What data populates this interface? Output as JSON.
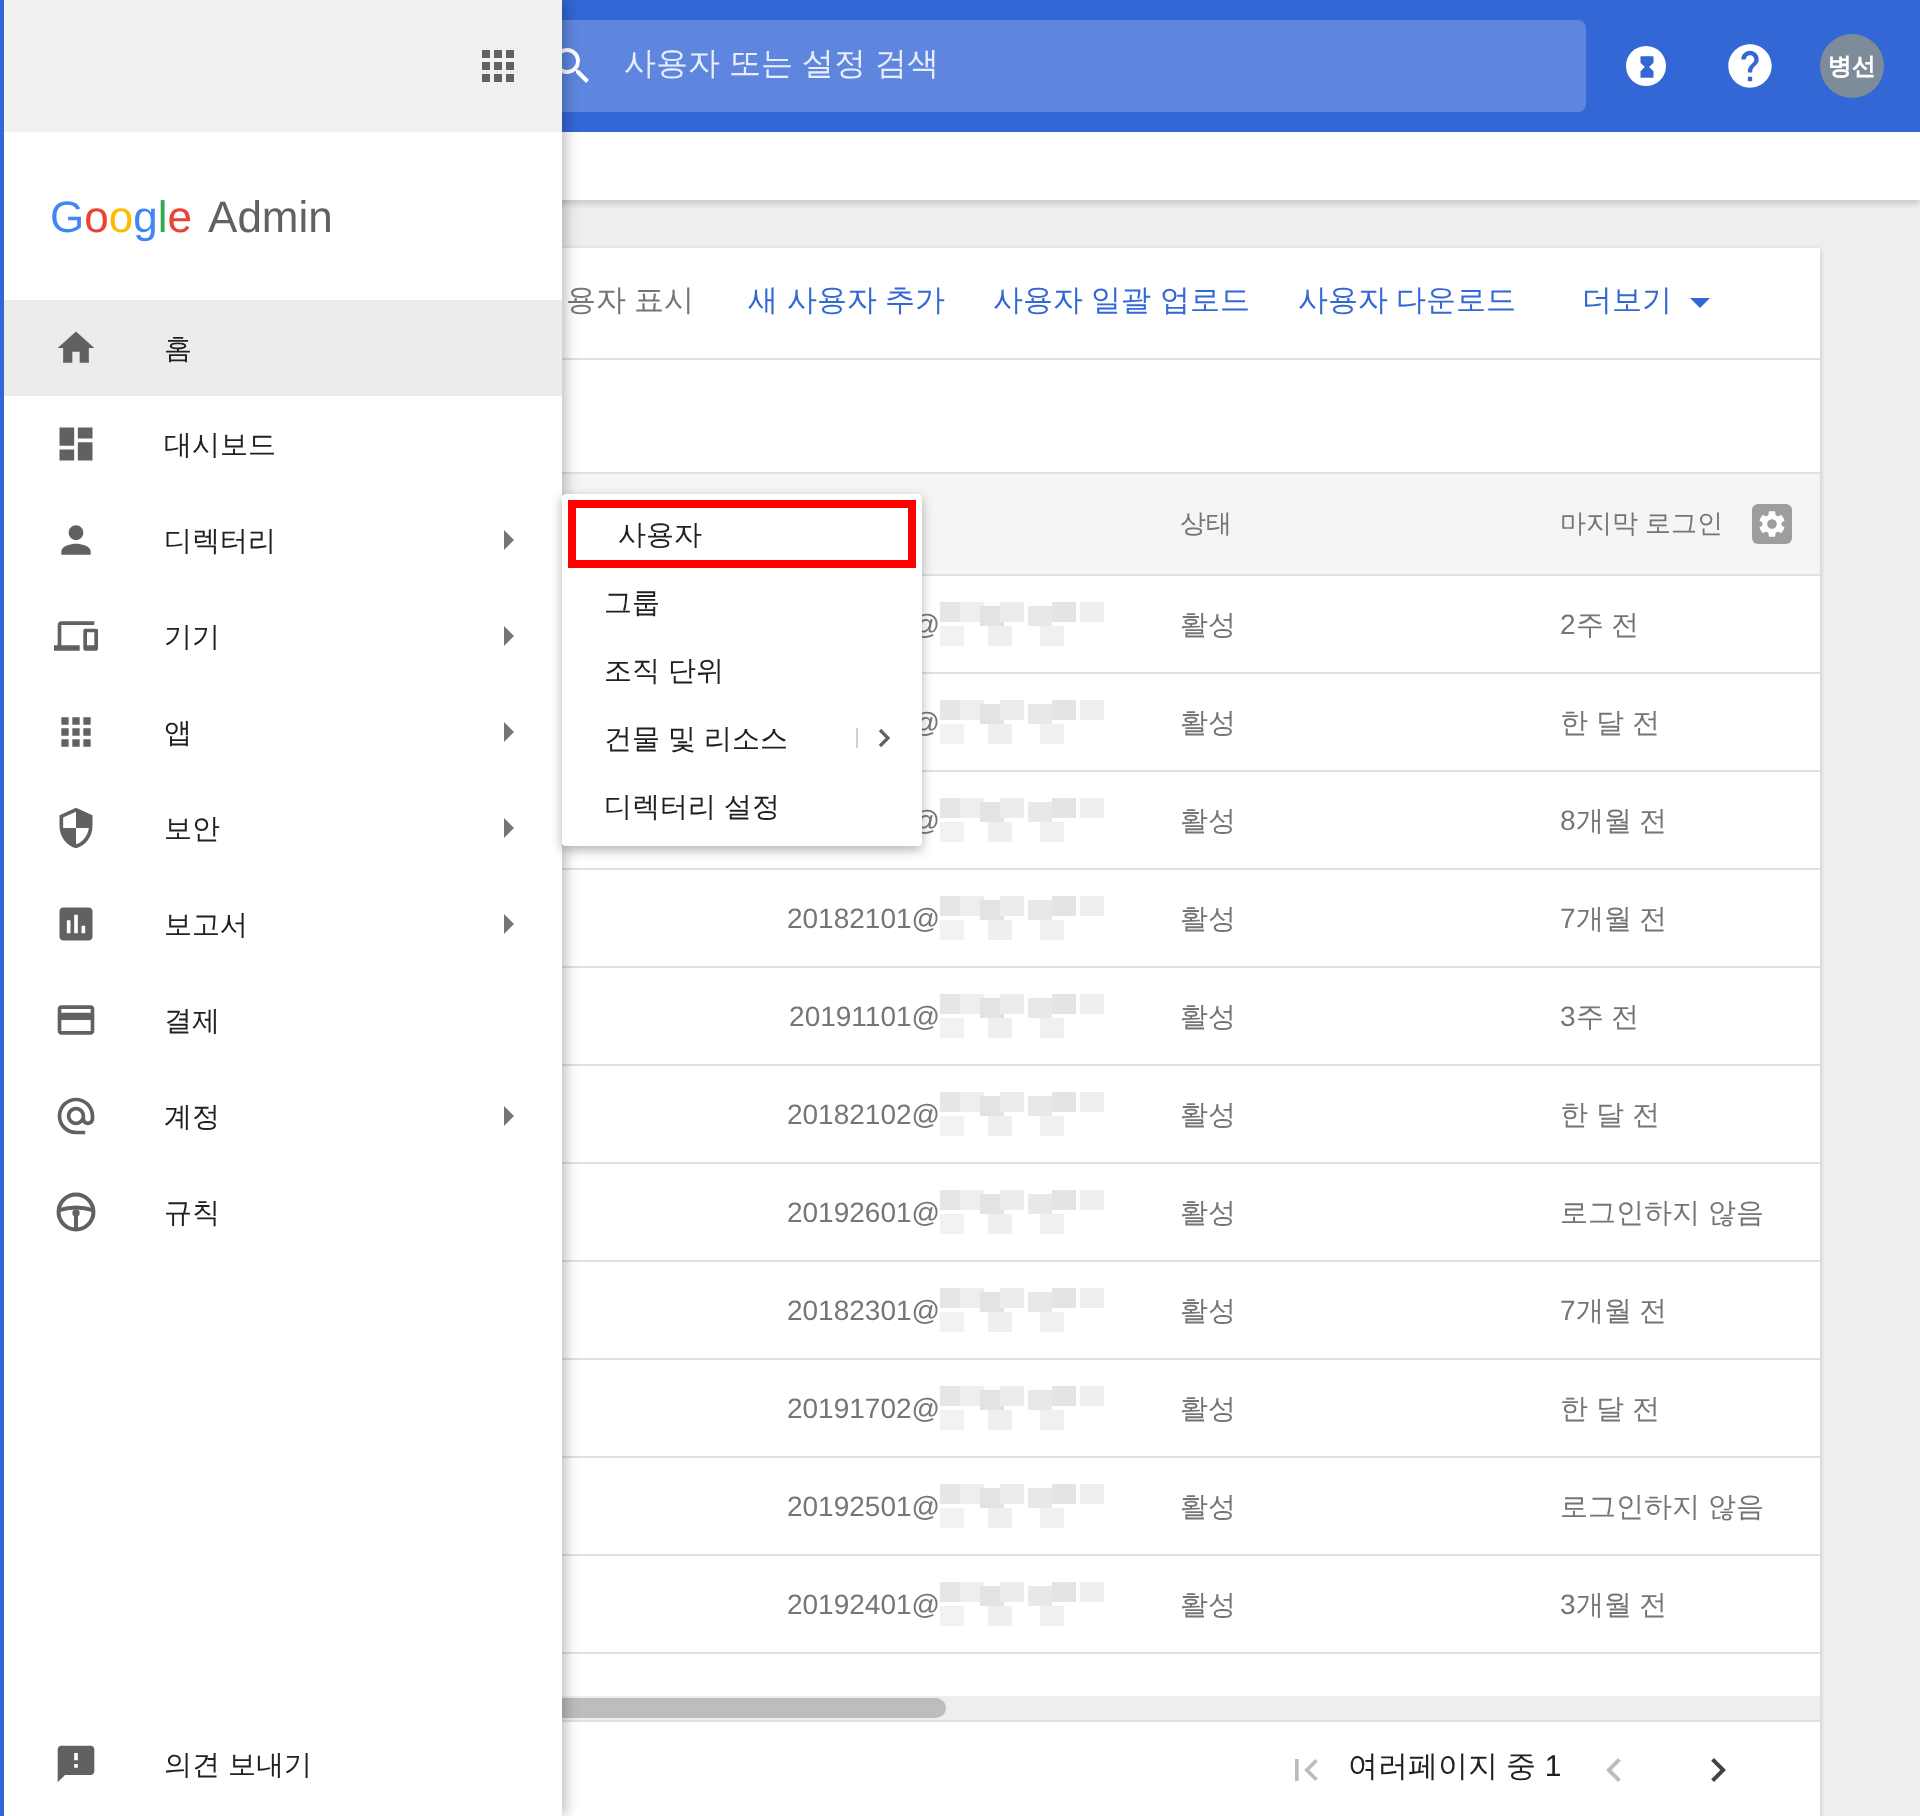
{
  "top_bar": {
    "search": {
      "placeholder": "사용자 또는 설정 검색"
    },
    "avatar": "병선"
  },
  "toolbar": {
    "partial_label": "용자 표시",
    "links": [
      "새 사용자 추가",
      "사용자 일괄 업로드",
      "사용자 다운로드"
    ],
    "more": "더보기"
  },
  "table": {
    "columns": [
      "상태",
      "마지막 로그인"
    ],
    "rows": [
      {
        "email": "@",
        "status": "활성",
        "last_login": "2주 전"
      },
      {
        "email": "@",
        "status": "활성",
        "last_login": "한 달 전"
      },
      {
        "email": "@",
        "status": "활성",
        "last_login": "8개월 전"
      },
      {
        "email": "20182101@",
        "status": "활성",
        "last_login": "7개월 전"
      },
      {
        "email": "20191101@",
        "status": "활성",
        "last_login": "3주 전"
      },
      {
        "email": "20182102@",
        "status": "활성",
        "last_login": "한 달 전"
      },
      {
        "email": "20192601@",
        "status": "활성",
        "last_login": "로그인하지 않음"
      },
      {
        "email": "20182301@",
        "status": "활성",
        "last_login": "7개월 전"
      },
      {
        "email": "20191702@",
        "status": "활성",
        "last_login": "한 달 전"
      },
      {
        "email": "20192501@",
        "status": "활성",
        "last_login": "로그인하지 않음"
      },
      {
        "email": "20192401@",
        "status": "활성",
        "last_login": "3개월 전"
      }
    ]
  },
  "pagination": {
    "label": "여러페이지 중 1",
    "first_disabled": true,
    "prev_disabled": true,
    "next_disabled": false
  },
  "sidebar": {
    "logo": "Google",
    "product": "Admin",
    "items": [
      {
        "label": "홈",
        "selected": true,
        "submenu": false
      },
      {
        "label": "대시보드",
        "selected": false,
        "submenu": false
      },
      {
        "label": "디렉터리",
        "selected": false,
        "submenu": true
      },
      {
        "label": "기기",
        "selected": false,
        "submenu": true
      },
      {
        "label": "앱",
        "selected": false,
        "submenu": true
      },
      {
        "label": "보안",
        "selected": false,
        "submenu": true
      },
      {
        "label": "보고서",
        "selected": false,
        "submenu": true
      },
      {
        "label": "결제",
        "selected": false,
        "submenu": false
      },
      {
        "label": "계정",
        "selected": false,
        "submenu": true
      },
      {
        "label": "규칙",
        "selected": false,
        "submenu": false
      }
    ],
    "feedback": "의견 보내기"
  },
  "submenu": {
    "items": [
      {
        "label": "사용자",
        "highlighted": true,
        "submenu": false
      },
      {
        "label": "그룹",
        "highlighted": false,
        "submenu": false
      },
      {
        "label": "조직 단위",
        "highlighted": false,
        "submenu": false
      },
      {
        "label": "건물 및 리소스",
        "highlighted": false,
        "submenu": true
      },
      {
        "label": "디렉터리 설정",
        "highlighted": false,
        "submenu": false
      }
    ]
  }
}
